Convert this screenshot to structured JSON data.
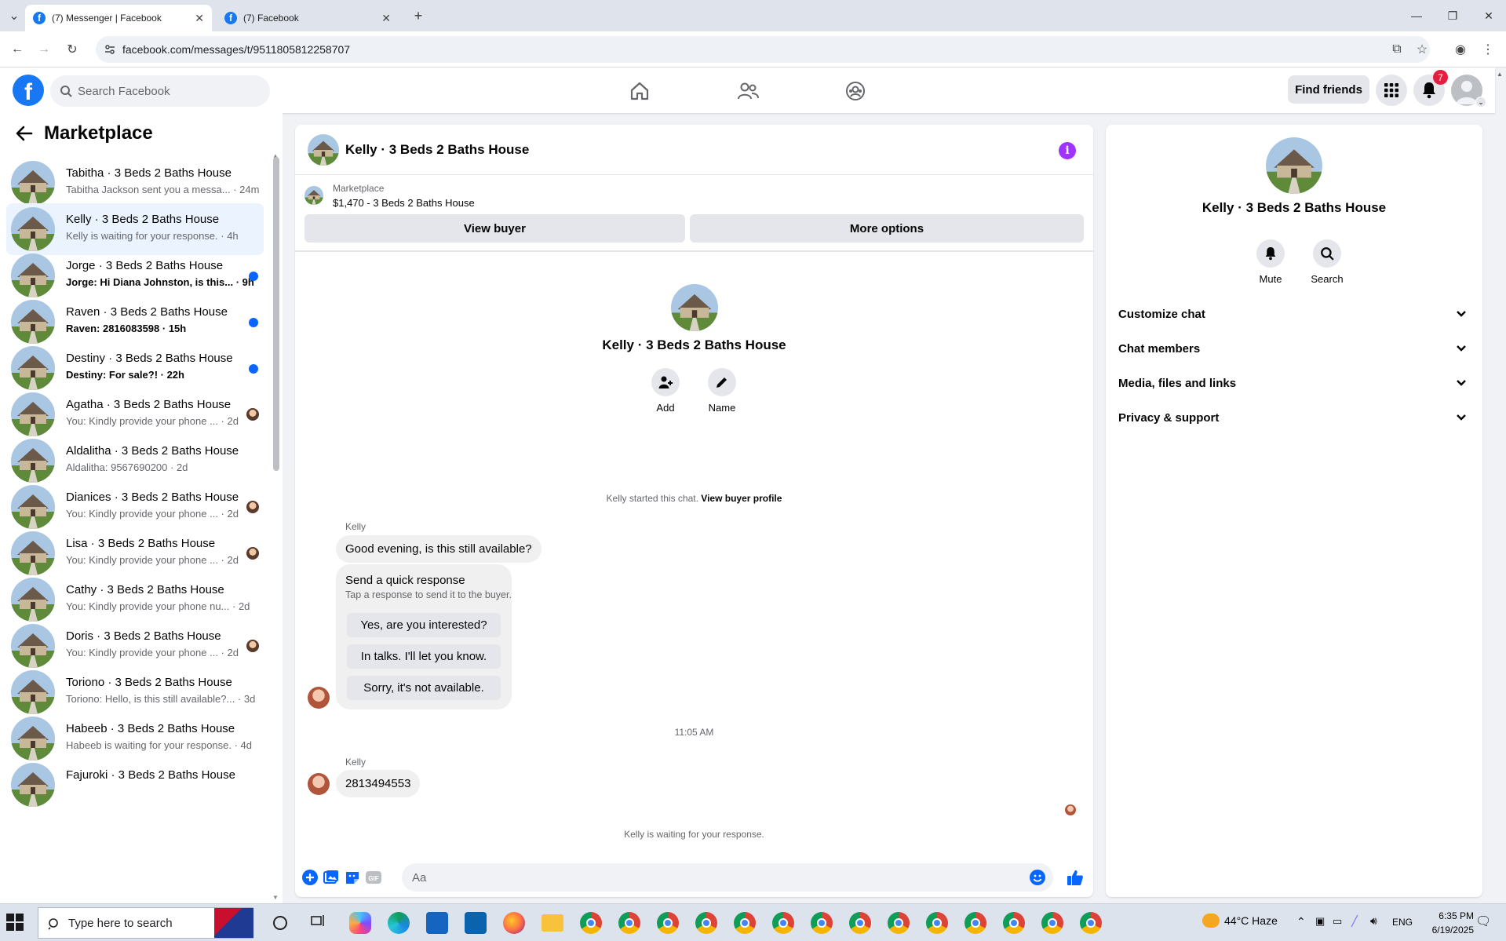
{
  "browser": {
    "tabs": [
      {
        "title": "(7) Messenger | Facebook",
        "active": true
      },
      {
        "title": "(7) Facebook",
        "active": false
      }
    ],
    "url": "facebook.com/messages/t/9511805812258707"
  },
  "header": {
    "search_placeholder": "Search Facebook",
    "find_friends_label": "Find friends",
    "notification_count": "7"
  },
  "sidebar": {
    "title": "Marketplace",
    "conversations": [
      {
        "title": "Tabitha · 3 Beds 2 Baths House",
        "preview": "Tabitha Jackson sent you a messa... · 24m",
        "unread": false,
        "selected": false,
        "indicator": "none"
      },
      {
        "title": "Kelly · 3 Beds 2 Baths House",
        "preview": "Kelly is waiting for your response. · 4h",
        "unread": false,
        "selected": true,
        "indicator": "none"
      },
      {
        "title": "Jorge · 3 Beds 2 Baths House",
        "preview": "Jorge: Hi Diana Johnston, is this... · 9h",
        "unread": true,
        "selected": false,
        "indicator": "dot"
      },
      {
        "title": "Raven · 3 Beds 2 Baths House",
        "preview": "Raven: 2816083598 · 15h",
        "unread": true,
        "selected": false,
        "indicator": "dot"
      },
      {
        "title": "Destiny · 3 Beds 2 Baths House",
        "preview": "Destiny: For sale?! · 22h",
        "unread": true,
        "selected": false,
        "indicator": "dot"
      },
      {
        "title": "Agatha · 3 Beds 2 Baths House",
        "preview": "You: Kindly provide your phone ... · 2d",
        "unread": false,
        "selected": false,
        "indicator": "avatar"
      },
      {
        "title": "Aldalitha · 3 Beds 2 Baths House",
        "preview": "Aldalitha: 9567690200 · 2d",
        "unread": false,
        "selected": false,
        "indicator": "none"
      },
      {
        "title": "Dianices · 3 Beds 2 Baths House",
        "preview": "You: Kindly provide your phone ... · 2d",
        "unread": false,
        "selected": false,
        "indicator": "avatar"
      },
      {
        "title": "Lisa · 3 Beds 2 Baths House",
        "preview": "You: Kindly provide your phone ... · 2d",
        "unread": false,
        "selected": false,
        "indicator": "avatar"
      },
      {
        "title": "Cathy · 3 Beds 2 Baths House",
        "preview": "You: Kindly provide your phone nu... · 2d",
        "unread": false,
        "selected": false,
        "indicator": "none"
      },
      {
        "title": "Doris · 3 Beds 2 Baths House",
        "preview": "You: Kindly provide your phone ... · 2d",
        "unread": false,
        "selected": false,
        "indicator": "avatar"
      },
      {
        "title": "Toriono · 3 Beds 2 Baths House",
        "preview": "Toriono: Hello, is this still available?... · 3d",
        "unread": false,
        "selected": false,
        "indicator": "none"
      },
      {
        "title": "Habeeb · 3 Beds 2 Baths House",
        "preview": "Habeeb is waiting for your response. · 4d",
        "unread": false,
        "selected": false,
        "indicator": "none"
      },
      {
        "title": "Fajuroki · 3 Beds 2 Baths House",
        "preview": "",
        "unread": false,
        "selected": false,
        "indicator": "none"
      }
    ]
  },
  "chat": {
    "title": "Kelly · 3 Beds 2 Baths House",
    "marketplace_label": "Marketplace",
    "listing": "$1,470 - 3 Beds 2 Baths House",
    "view_buyer_label": "View buyer",
    "more_options_label": "More options",
    "center_title": "Kelly · 3 Beds 2 Baths House",
    "add_label": "Add",
    "name_label": "Name",
    "started_text": "Kelly started this chat.",
    "view_buyer_profile": "View buyer profile",
    "sender_name": "Kelly",
    "message_1": "Good evening, is this still available?",
    "quick_title": "Send a quick response",
    "quick_sub": "Tap a response to send it to the buyer.",
    "quick_replies": [
      "Yes, are you interested?",
      "In talks. I'll let you know.",
      "Sorry, it's not available."
    ],
    "timestamp": "11:05 AM",
    "message_2": "2813494553",
    "waiting_text": "Kelly is waiting for your response.",
    "input_placeholder": "Aa"
  },
  "info_panel": {
    "title": "Kelly · 3 Beds 2 Baths House",
    "mute_label": "Mute",
    "search_label": "Search",
    "sections": [
      "Customize chat",
      "Chat members",
      "Media, files and links",
      "Privacy & support"
    ]
  },
  "taskbar": {
    "search_placeholder": "Type here to search",
    "weather": "44°C  Haze",
    "language": "ENG",
    "time": "6:35 PM",
    "date": "6/19/2025"
  },
  "colors": {
    "brand_blue": "#1877f2",
    "unread_dot": "#0866ff",
    "info_purple": "#a033ff",
    "selected_bg": "#eaf3fe",
    "badge_red": "#e41e3f"
  }
}
